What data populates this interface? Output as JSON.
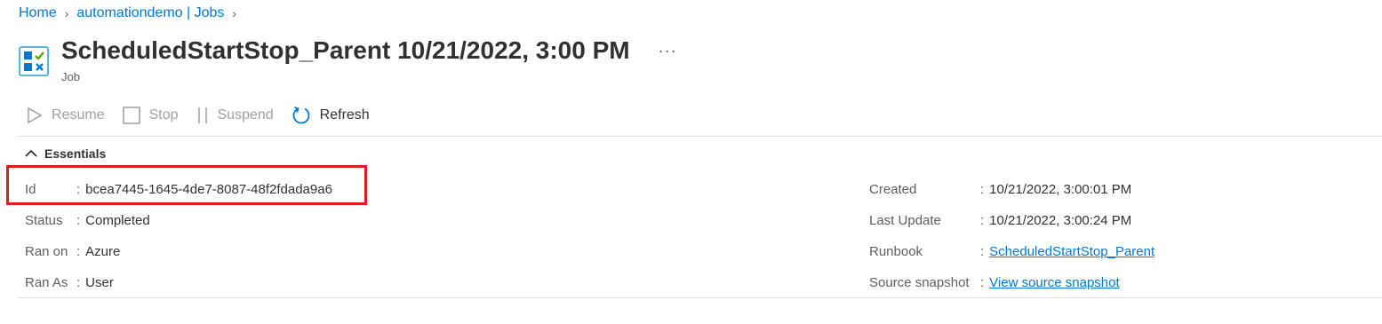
{
  "breadcrumb": [
    {
      "label": "Home"
    },
    {
      "label": "automationdemo | Jobs"
    }
  ],
  "header": {
    "title": "ScheduledStartStop_Parent 10/21/2022, 3:00 PM",
    "subtitle": "Job",
    "more_label": "···"
  },
  "toolbar": {
    "resume": "Resume",
    "stop": "Stop",
    "suspend": "Suspend",
    "refresh": "Refresh"
  },
  "essentials": {
    "heading": "Essentials",
    "left": [
      {
        "key": "Id",
        "value": "bcea7445-1645-4de7-8087-48f2fdada9a6"
      },
      {
        "key": "Status",
        "value": "Completed"
      },
      {
        "key": "Ran on",
        "value": "Azure"
      },
      {
        "key": "Ran As",
        "value": "User"
      }
    ],
    "right": [
      {
        "key": "Created",
        "value": "10/21/2022, 3:00:01 PM"
      },
      {
        "key": "Last Update",
        "value": "10/21/2022, 3:00:24 PM"
      },
      {
        "key": "Runbook",
        "value": "ScheduledStartStop_Parent"
      },
      {
        "key": "Source snapshot",
        "value": "View source snapshot"
      }
    ]
  },
  "colors": {
    "accent": "#0078d4",
    "highlight": "#e21b23"
  }
}
